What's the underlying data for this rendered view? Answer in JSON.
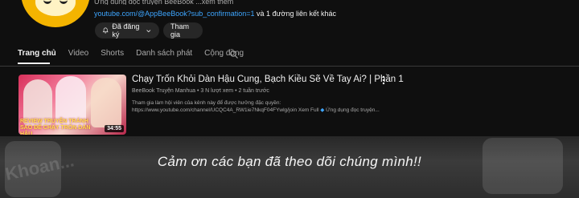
{
  "channel": {
    "description_faded": "Ứng dụng đọc truyện BeeBook ...xem thêm",
    "link": "youtube.com/@AppBeeBook?sub_confirmation=1",
    "more_links": " và 1 đường liên kết khác",
    "subscribed_label": "Đã đăng ký",
    "join_label": "Tham gia"
  },
  "tabs": [
    {
      "label": "Trang chủ"
    },
    {
      "label": "Video"
    },
    {
      "label": "Shorts"
    },
    {
      "label": "Danh sách phát"
    },
    {
      "label": "Cộng đồng"
    }
  ],
  "video": {
    "title": "Chạy Trốn Khỏi Dàn Hậu Cung, Bạch Kiều Sẽ Về Tay Ai? | Phần 1",
    "meta": "BeeBook Truyện Manhua • 3 N lượt xem • 2 tuần trước",
    "desc_line1": "Tham gia làm hội viên của kênh này để được hưởng đặc quyền:",
    "desc_line2": "https://www.youtube.com/channel/UCQC4A_RW1ie7NkqF04FYwlg/join Xem Full",
    "desc_line2_extra": "Ứng dụng đọc truyện...",
    "duration": "34:55",
    "thumb_text": "REVIEW TRUYỆN TRÁNH SAO ĐỂ CHẠY TRỐN DÀN HẬU"
  },
  "caption": "Cảm ơn các bạn đã theo dõi chúng mình!!",
  "background_ghost_text": "Khoan...",
  "colors": {
    "background": "#0f0f0f",
    "link": "#3ea6ff",
    "pill": "#272727",
    "muted": "#aaaaaa"
  }
}
